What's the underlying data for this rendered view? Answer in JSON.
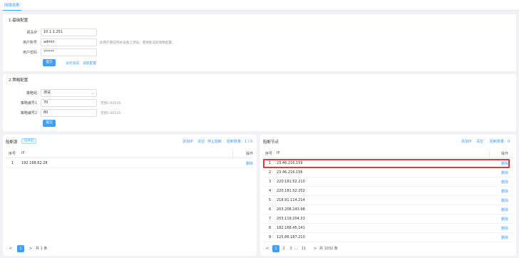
{
  "tab": {
    "label": "网络劫断"
  },
  "basic": {
    "title": "1.基础配置",
    "gateway_label": "网关IP",
    "gateway_value": "10.1.1.251",
    "account_label": "用户账号",
    "account_value": "admin",
    "account_hint": "此用户需在网关设备上添加，需要能读取策略配置。",
    "password_label": "用户密码",
    "password_value": "******",
    "submit": "提交",
    "test_link": "访问测试",
    "read_link": "读取配置"
  },
  "strategy": {
    "title": "2.策略配置",
    "policy_label": "策略组",
    "policy_value": "测试",
    "num1_label": "策略编号1",
    "num1_value": "70",
    "num1_hint": "范围1-65535",
    "num2_label": "策略编号2",
    "num2_value": "80",
    "num2_hint": "范围1-65535",
    "submit": "提交"
  },
  "left_panel": {
    "title": "阻断源",
    "tag": "已开启",
    "actions": [
      "添加IP",
      "清空",
      "停止阻断"
    ],
    "count": "阻断数量：1 / 0",
    "col_index": "序号",
    "col_ip": "IP",
    "col_op": "操作",
    "rows": [
      {
        "index": "1",
        "ip": "192.168.62.28",
        "op": "删除"
      }
    ],
    "pager": {
      "prev": "<",
      "page": "1",
      "next": ">",
      "total": "共 1 条"
    }
  },
  "right_panel": {
    "title": "阻断节点",
    "actions": [
      "添加IP",
      "清空"
    ],
    "count": "阻断数量：0",
    "col_index": "序号",
    "col_ip": "IP",
    "col_op": "操作",
    "rows": [
      {
        "index": "1",
        "ip": "23.46.216.159",
        "op": "删除"
      },
      {
        "index": "2",
        "ip": "23.46.216.156",
        "op": "删除"
      },
      {
        "index": "3",
        "ip": "220.181.52.210",
        "op": "删除"
      },
      {
        "index": "4",
        "ip": "220.181.52.202",
        "op": "删除"
      },
      {
        "index": "5",
        "ip": "218.91.114.214",
        "op": "删除"
      },
      {
        "index": "6",
        "ip": "203.208.243.98",
        "op": "删除"
      },
      {
        "index": "7",
        "ip": "203.119.204.33",
        "op": "删除"
      },
      {
        "index": "8",
        "ip": "182.168.45.141",
        "op": "删除"
      },
      {
        "index": "9",
        "ip": "125.88.187.210",
        "op": "删除"
      }
    ],
    "pager": {
      "prev": "<",
      "p1": "1",
      "p2": "2",
      "p3": "3",
      "ellipsis": "...",
      "plast": "11",
      "next": ">",
      "total": "共 1032 条"
    }
  },
  "colors": {
    "primary": "#409eff",
    "highlight": "#e53935"
  }
}
